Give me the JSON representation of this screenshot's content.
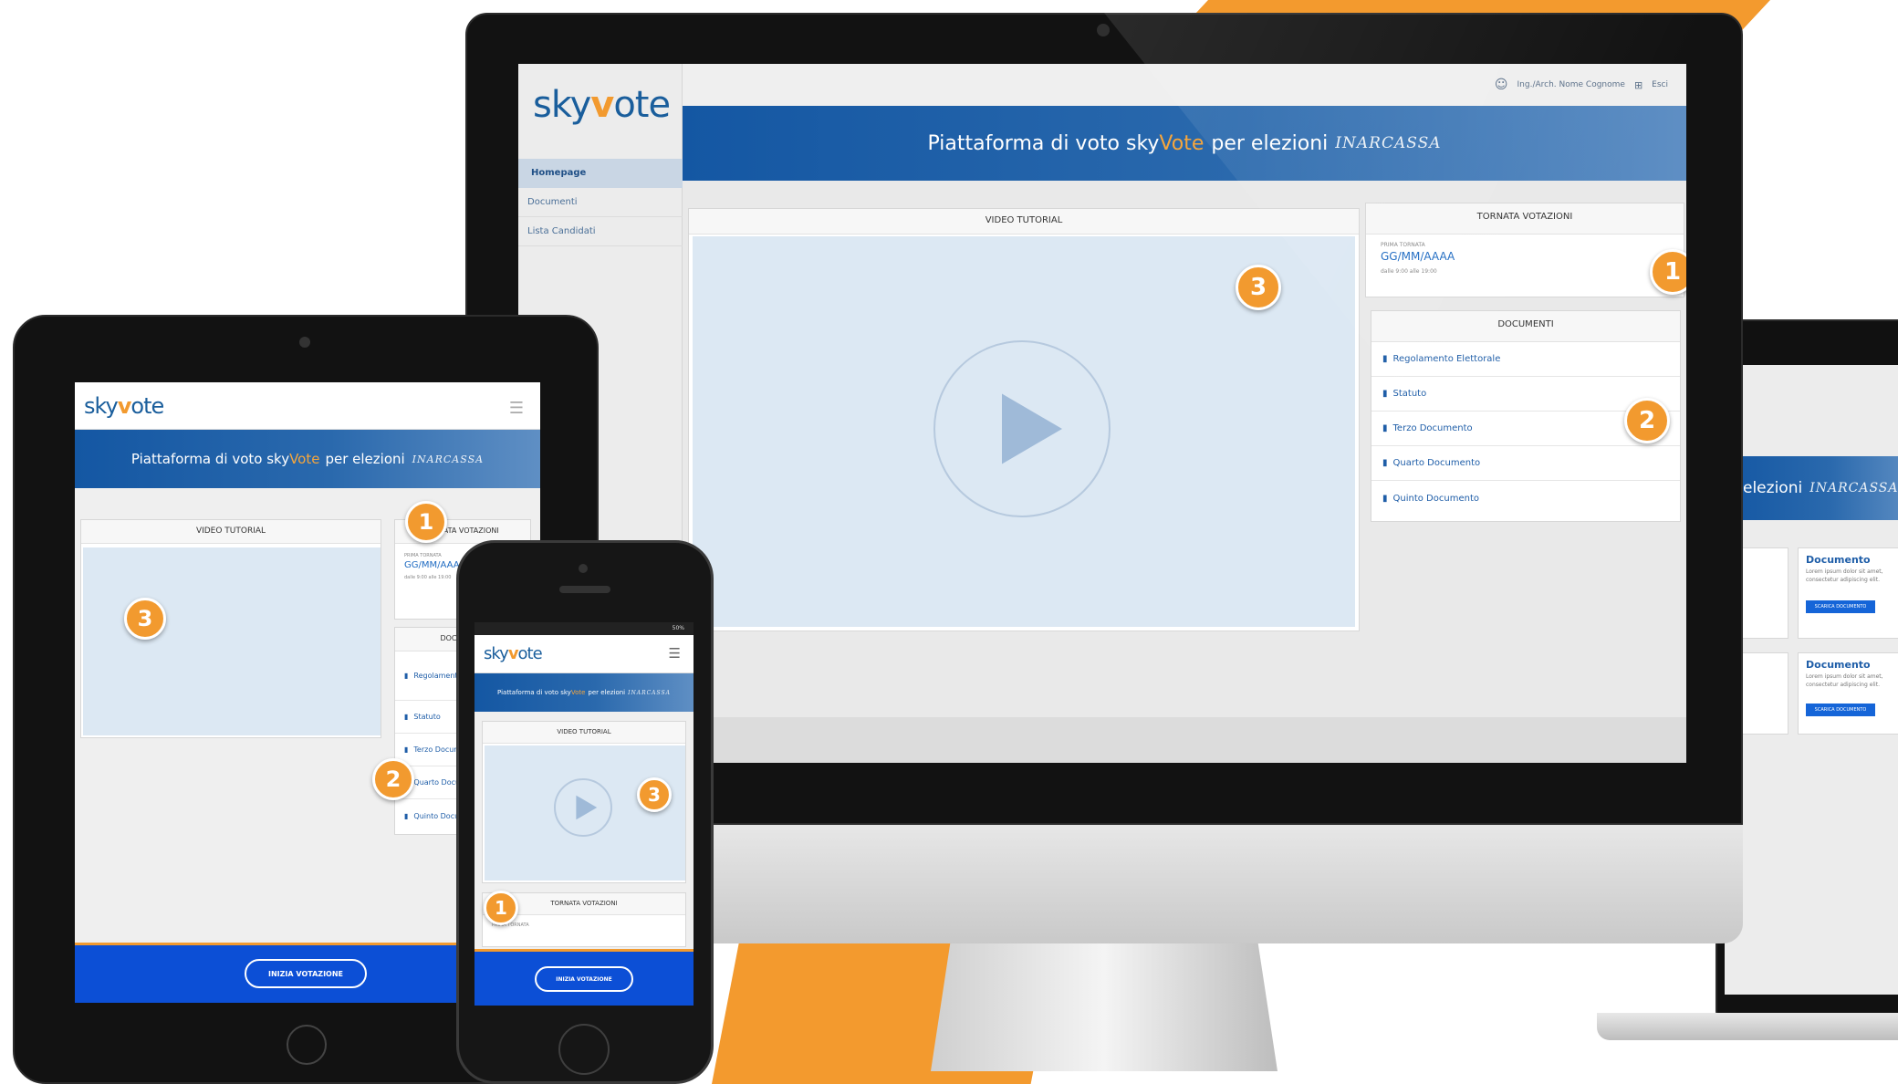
{
  "platform": {
    "logo_prefix": "sky",
    "logo_mark": "v",
    "logo_suffix": "ote",
    "banner_prefix": "Piattaforma di voto sky",
    "banner_highlight": "Vote",
    "banner_suffix": "per elezioni",
    "banner_brand": "INARCASSA"
  },
  "desktop": {
    "user_label": "Ing./Arch. Nome Cognome",
    "exit_label": "Esci",
    "nav": [
      "Homepage",
      "Documenti",
      "Lista Candidati"
    ],
    "video_title": "VIDEO TUTORIAL",
    "tornata_title": "TORNATA VOTAZIONI",
    "tornata_kicker": "PRIMA TORNATA",
    "tornata_date": "GG/MM/AAAA",
    "tornata_hours": "dalle 9:00 alle 19:00",
    "documents_title": "DOCUMENTI",
    "documents": [
      "Regolamento Elettorale",
      "Statuto",
      "Terzo Documento",
      "Quarto Documento",
      "Quinto Documento"
    ],
    "badges": [
      "1",
      "2",
      "3"
    ]
  },
  "laptop": {
    "banner_visible": "elezioni",
    "cards": [
      {
        "title": "Documento",
        "text": "Lorem ipsum dolor sit amet, consectetur adipiscing elit.",
        "button": "SCARICA DOCUMENTO"
      },
      {
        "title": "Documento",
        "text": "Lorem ipsum dolor sit amet, consectetur adipiscing elit.",
        "button": "SCARICA DOCUMENTO"
      }
    ]
  },
  "tablet": {
    "video_title": "VIDEO TUTORIAL",
    "tornata_title": "TORNATA VOTAZIONI",
    "tornata_kicker": "PRIMA TORNATA",
    "tornata_date": "GG/MM/AAAA",
    "tornata_hours": "dalle 9:00 alle 19:00",
    "documents_title": "DOCUMENTI",
    "documents": [
      "Regolamento Elettorale",
      "Statuto",
      "Terzo Documento",
      "Quarto Documento",
      "Quinto Documento"
    ],
    "cta": "INIZIA VOTAZIONE",
    "badges": [
      "1",
      "2",
      "3"
    ]
  },
  "phone": {
    "status": "50%",
    "video_title": "VIDEO TUTORIAL",
    "tornata_title": "TORNATA VOTAZIONI",
    "tornata_kicker": "PRIMA TORNATA",
    "cta": "INIZIA VOTAZIONE",
    "badges": [
      "1",
      "3"
    ]
  },
  "colors": {
    "accent": "#f29a2f",
    "brand_blue": "#1457a3",
    "cta_blue": "#0c4fd6",
    "video_bg": "#dce8f3"
  },
  "icons": [
    "play-icon",
    "document-icon",
    "hamburger-menu-icon",
    "user-icon",
    "exit-icon"
  ]
}
